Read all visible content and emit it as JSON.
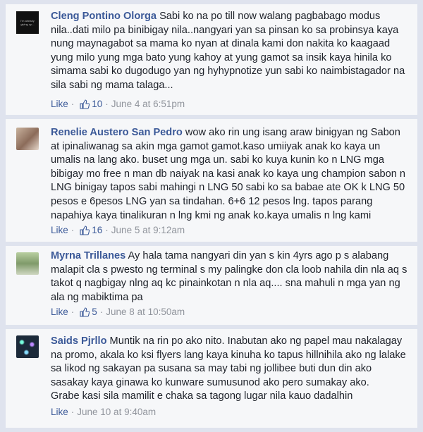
{
  "comments": [
    {
      "author": "Cleng Pontino Olorga",
      "avatar_text": "I'm already giving up...",
      "text": "Sabi ko na po till now walang pagbabago modus nila..dati milo pa binibigay nila..nangyari yan sa pinsan ko sa probinsya kaya nung maynagabot sa mama ko nyan at dinala kami don nakita ko kaagaad yung milo yung mga bato yung kahoy at yung gamot sa insik kaya hinila ko simama sabi ko dugodugo yan ng hyhypnotize yun sabi ko naimbistagador na sila sabi ng mama talaga...",
      "like_label": "Like",
      "likes": "10",
      "time": "June 4 at 6:51pm"
    },
    {
      "author": "Renelie Austero San Pedro",
      "text": "wow ako rin ung isang araw binigyan ng Sabon at ipinaliwanag sa akin mga gamot gamot.kaso umiiyak anak ko kaya un umalis na lang ako. buset ung mga un. sabi ko kuya kunin ko n LNG mga bibigay mo free n man db naiyak na kasi anak ko kaya ung champion sabon n LNG binigay tapos sabi mahingi n LNG 50 sabi ko sa babae ate OK k LNG 50 pesos e 6pesos LNG yan sa tindahan. 6+6 12 pesos lng. tapos parang napahiya kaya tinalikuran n lng kmi ng anak ko.kaya umalis n lng kami",
      "like_label": "Like",
      "likes": "16",
      "time": "June 5 at 9:12am"
    },
    {
      "author": "Myrna Trillanes",
      "text": "Ay hala tama nangyari din yan s kin 4yrs ago p s alabang malapit cla s pwesto ng terminal s my palingke don cla loob nahila din nla aq s takot q nagbigay nlng aq kc pinainkotan n nla aq.... sna mahuli n mga yan ng ala ng mabiktima pa",
      "like_label": "Like",
      "likes": "5",
      "time": "June 8 at 10:50am"
    },
    {
      "author": "Saids Pjrllo",
      "text": "Muntik na rin po ako nito. Inabutan ako ng papel mau nakalagay na promo, akala ko ksi flyers lang kaya kinuha ko tapus hillnihila ako ng lalake sa likod ng sakayan pa susana sa may tabi ng jollibee buti dun din ako sasakay kaya ginawa ko kunware sumusunod ako pero sumakay ako.",
      "text2": "Grabe kasi sila mamilit e chaka sa tagong lugar nila kauo dadalhin",
      "like_label": "Like",
      "time": "June 10 at 9:40am"
    }
  ],
  "colors": {
    "author": "#3b5998",
    "meta": "#90949c",
    "bg": "#dfe3ee",
    "card": "#f6f7f9"
  },
  "icons": {
    "like": "thumbs-up-icon"
  }
}
